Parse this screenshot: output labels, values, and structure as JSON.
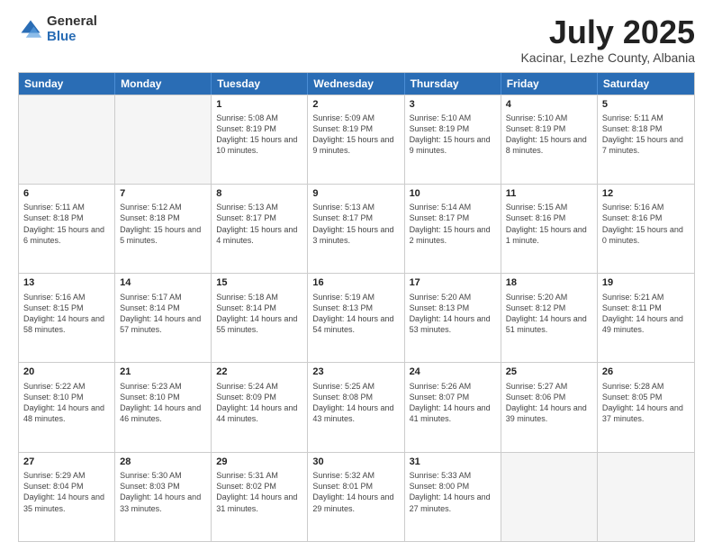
{
  "logo": {
    "general": "General",
    "blue": "Blue"
  },
  "title": "July 2025",
  "subtitle": "Kacinar, Lezhe County, Albania",
  "header_days": [
    "Sunday",
    "Monday",
    "Tuesday",
    "Wednesday",
    "Thursday",
    "Friday",
    "Saturday"
  ],
  "weeks": [
    [
      {
        "day": "",
        "info": ""
      },
      {
        "day": "",
        "info": ""
      },
      {
        "day": "1",
        "info": "Sunrise: 5:08 AM\nSunset: 8:19 PM\nDaylight: 15 hours and 10 minutes."
      },
      {
        "day": "2",
        "info": "Sunrise: 5:09 AM\nSunset: 8:19 PM\nDaylight: 15 hours and 9 minutes."
      },
      {
        "day": "3",
        "info": "Sunrise: 5:10 AM\nSunset: 8:19 PM\nDaylight: 15 hours and 9 minutes."
      },
      {
        "day": "4",
        "info": "Sunrise: 5:10 AM\nSunset: 8:19 PM\nDaylight: 15 hours and 8 minutes."
      },
      {
        "day": "5",
        "info": "Sunrise: 5:11 AM\nSunset: 8:18 PM\nDaylight: 15 hours and 7 minutes."
      }
    ],
    [
      {
        "day": "6",
        "info": "Sunrise: 5:11 AM\nSunset: 8:18 PM\nDaylight: 15 hours and 6 minutes."
      },
      {
        "day": "7",
        "info": "Sunrise: 5:12 AM\nSunset: 8:18 PM\nDaylight: 15 hours and 5 minutes."
      },
      {
        "day": "8",
        "info": "Sunrise: 5:13 AM\nSunset: 8:17 PM\nDaylight: 15 hours and 4 minutes."
      },
      {
        "day": "9",
        "info": "Sunrise: 5:13 AM\nSunset: 8:17 PM\nDaylight: 15 hours and 3 minutes."
      },
      {
        "day": "10",
        "info": "Sunrise: 5:14 AM\nSunset: 8:17 PM\nDaylight: 15 hours and 2 minutes."
      },
      {
        "day": "11",
        "info": "Sunrise: 5:15 AM\nSunset: 8:16 PM\nDaylight: 15 hours and 1 minute."
      },
      {
        "day": "12",
        "info": "Sunrise: 5:16 AM\nSunset: 8:16 PM\nDaylight: 15 hours and 0 minutes."
      }
    ],
    [
      {
        "day": "13",
        "info": "Sunrise: 5:16 AM\nSunset: 8:15 PM\nDaylight: 14 hours and 58 minutes."
      },
      {
        "day": "14",
        "info": "Sunrise: 5:17 AM\nSunset: 8:14 PM\nDaylight: 14 hours and 57 minutes."
      },
      {
        "day": "15",
        "info": "Sunrise: 5:18 AM\nSunset: 8:14 PM\nDaylight: 14 hours and 55 minutes."
      },
      {
        "day": "16",
        "info": "Sunrise: 5:19 AM\nSunset: 8:13 PM\nDaylight: 14 hours and 54 minutes."
      },
      {
        "day": "17",
        "info": "Sunrise: 5:20 AM\nSunset: 8:13 PM\nDaylight: 14 hours and 53 minutes."
      },
      {
        "day": "18",
        "info": "Sunrise: 5:20 AM\nSunset: 8:12 PM\nDaylight: 14 hours and 51 minutes."
      },
      {
        "day": "19",
        "info": "Sunrise: 5:21 AM\nSunset: 8:11 PM\nDaylight: 14 hours and 49 minutes."
      }
    ],
    [
      {
        "day": "20",
        "info": "Sunrise: 5:22 AM\nSunset: 8:10 PM\nDaylight: 14 hours and 48 minutes."
      },
      {
        "day": "21",
        "info": "Sunrise: 5:23 AM\nSunset: 8:10 PM\nDaylight: 14 hours and 46 minutes."
      },
      {
        "day": "22",
        "info": "Sunrise: 5:24 AM\nSunset: 8:09 PM\nDaylight: 14 hours and 44 minutes."
      },
      {
        "day": "23",
        "info": "Sunrise: 5:25 AM\nSunset: 8:08 PM\nDaylight: 14 hours and 43 minutes."
      },
      {
        "day": "24",
        "info": "Sunrise: 5:26 AM\nSunset: 8:07 PM\nDaylight: 14 hours and 41 minutes."
      },
      {
        "day": "25",
        "info": "Sunrise: 5:27 AM\nSunset: 8:06 PM\nDaylight: 14 hours and 39 minutes."
      },
      {
        "day": "26",
        "info": "Sunrise: 5:28 AM\nSunset: 8:05 PM\nDaylight: 14 hours and 37 minutes."
      }
    ],
    [
      {
        "day": "27",
        "info": "Sunrise: 5:29 AM\nSunset: 8:04 PM\nDaylight: 14 hours and 35 minutes."
      },
      {
        "day": "28",
        "info": "Sunrise: 5:30 AM\nSunset: 8:03 PM\nDaylight: 14 hours and 33 minutes."
      },
      {
        "day": "29",
        "info": "Sunrise: 5:31 AM\nSunset: 8:02 PM\nDaylight: 14 hours and 31 minutes."
      },
      {
        "day": "30",
        "info": "Sunrise: 5:32 AM\nSunset: 8:01 PM\nDaylight: 14 hours and 29 minutes."
      },
      {
        "day": "31",
        "info": "Sunrise: 5:33 AM\nSunset: 8:00 PM\nDaylight: 14 hours and 27 minutes."
      },
      {
        "day": "",
        "info": ""
      },
      {
        "day": "",
        "info": ""
      }
    ]
  ]
}
